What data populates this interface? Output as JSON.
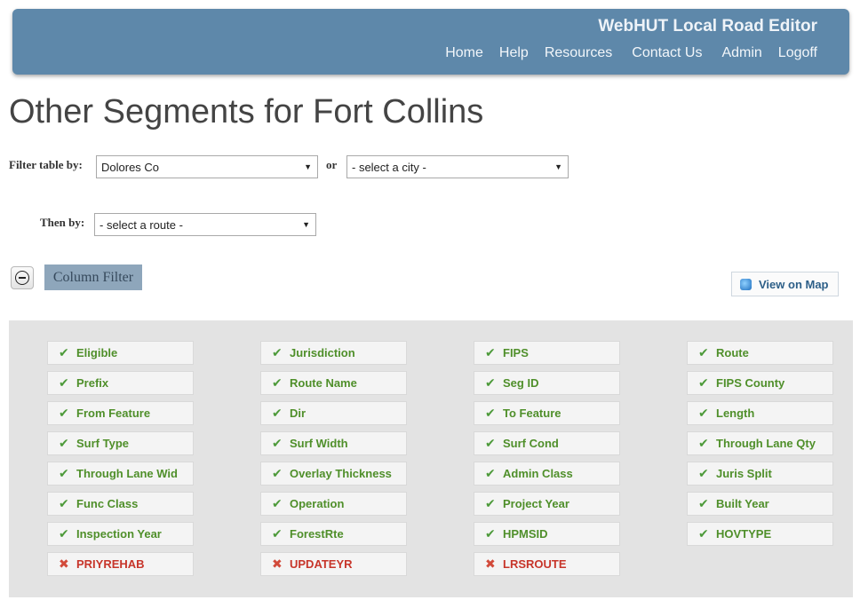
{
  "header": {
    "app_title": "WebHUT Local Road Editor",
    "nav": [
      "Home",
      "Help",
      "Resources",
      "Contact Us",
      "Admin",
      "Logoff"
    ]
  },
  "page_title": "Other Segments for Fort Collins",
  "filters": {
    "filter_label": "Filter table by:",
    "county_value": "Dolores Co",
    "or_label": "or",
    "city_value": "- select a city -",
    "then_label": "Then by:",
    "route_value": "- select a route -"
  },
  "column_filter_label": "Column Filter",
  "view_on_map_label": "View on Map",
  "columns": [
    [
      {
        "label": "Eligible",
        "checked": true
      },
      {
        "label": "Prefix",
        "checked": true
      },
      {
        "label": "From Feature",
        "checked": true
      },
      {
        "label": "Surf Type",
        "checked": true
      },
      {
        "label": "Through Lane Wid",
        "checked": true
      },
      {
        "label": "Func Class",
        "checked": true
      },
      {
        "label": "Inspection Year",
        "checked": true
      },
      {
        "label": "PRIYREHAB",
        "checked": false
      }
    ],
    [
      {
        "label": "Jurisdiction",
        "checked": true
      },
      {
        "label": "Route Name",
        "checked": true
      },
      {
        "label": "Dir",
        "checked": true
      },
      {
        "label": "Surf Width",
        "checked": true
      },
      {
        "label": "Overlay Thickness",
        "checked": true
      },
      {
        "label": "Operation",
        "checked": true
      },
      {
        "label": "ForestRte",
        "checked": true
      },
      {
        "label": "UPDATEYR",
        "checked": false
      }
    ],
    [
      {
        "label": "FIPS",
        "checked": true
      },
      {
        "label": "Seg ID",
        "checked": true
      },
      {
        "label": "To Feature",
        "checked": true
      },
      {
        "label": "Surf Cond",
        "checked": true
      },
      {
        "label": "Admin Class",
        "checked": true
      },
      {
        "label": "Project Year",
        "checked": true
      },
      {
        "label": "HPMSID",
        "checked": true
      },
      {
        "label": "LRSROUTE",
        "checked": false
      }
    ],
    [
      {
        "label": "Route",
        "checked": true
      },
      {
        "label": "FIPS County",
        "checked": true
      },
      {
        "label": "Length",
        "checked": true
      },
      {
        "label": "Through Lane Qty",
        "checked": true
      },
      {
        "label": "Juris Split",
        "checked": true
      },
      {
        "label": "Built Year",
        "checked": true
      },
      {
        "label": "HOVTYPE",
        "checked": true
      }
    ]
  ],
  "colors": {
    "banner": "#5e88aa",
    "checked_text": "#4f8f2a",
    "unchecked_text": "#c7352a"
  }
}
